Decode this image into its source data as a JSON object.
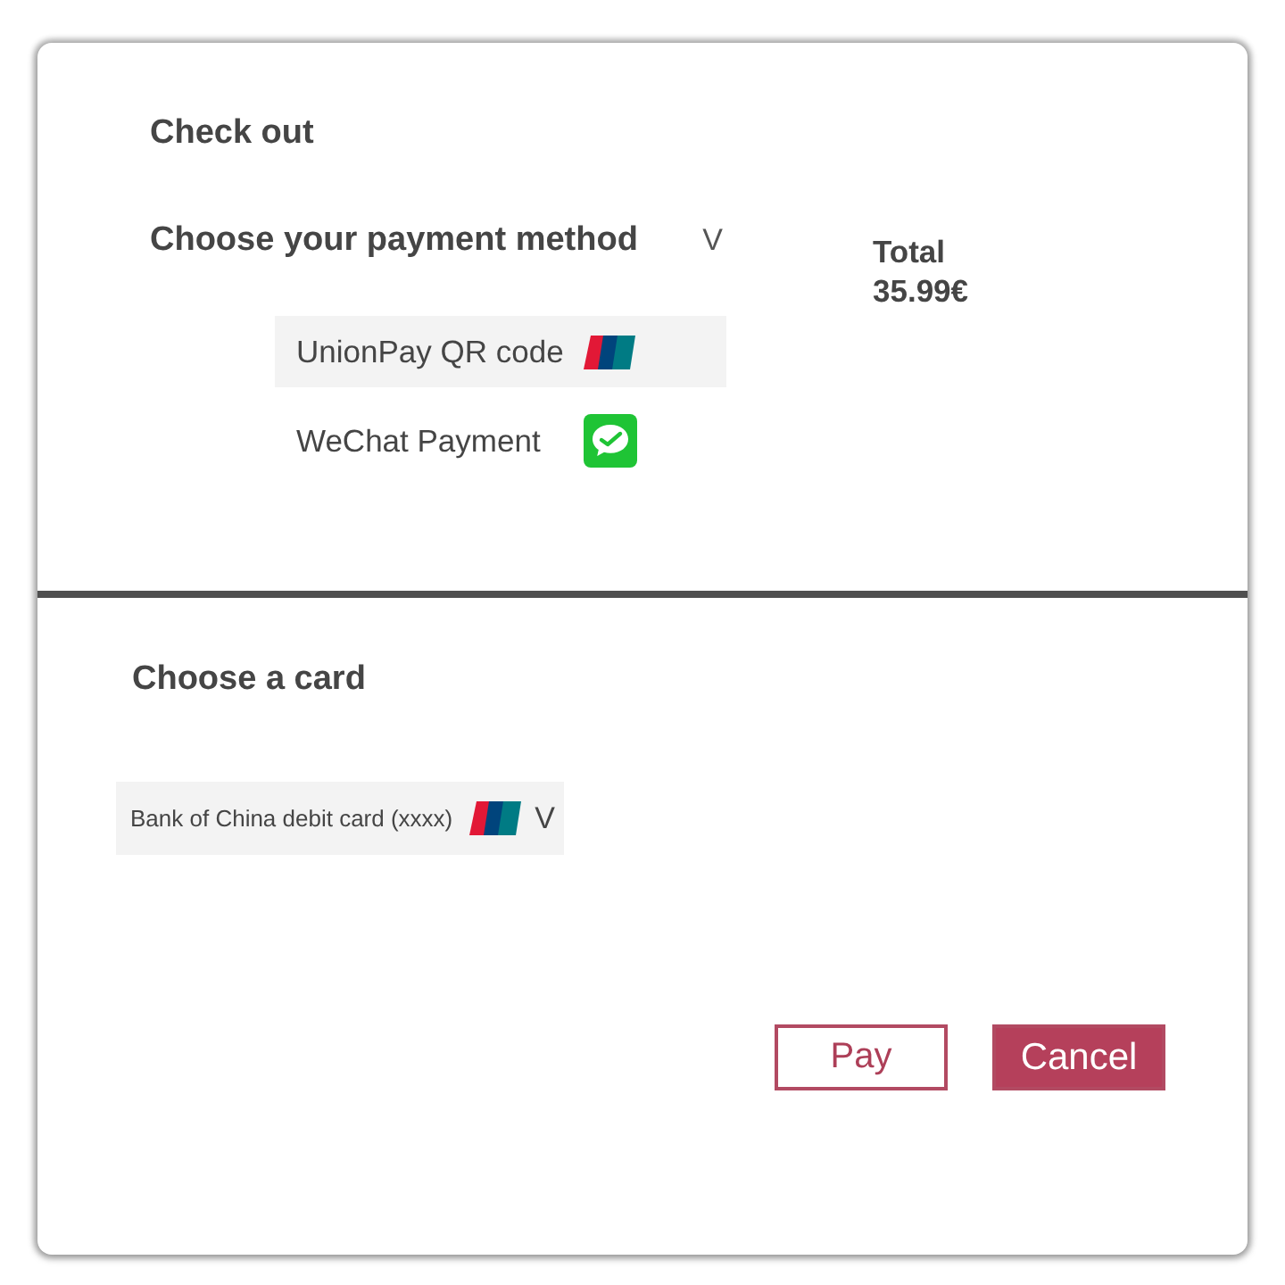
{
  "title": "Check out",
  "payment": {
    "label": "Choose your payment method",
    "toggle": "V",
    "options": [
      {
        "label": "UnionPay QR code",
        "kind": "unionpay",
        "selected": true
      },
      {
        "label": "WeChat Payment",
        "kind": "wechat",
        "selected": false
      }
    ]
  },
  "total": {
    "label": "Total",
    "amount": "35.99€"
  },
  "card": {
    "label": "Choose a card",
    "selection": {
      "text": "Bank of China debit card (xxxx)",
      "kind": "unionpay",
      "toggle": "V"
    }
  },
  "buttons": [
    {
      "label": "Pay",
      "kind": "outline"
    },
    {
      "label": "Cancel",
      "kind": "filled"
    }
  ]
}
